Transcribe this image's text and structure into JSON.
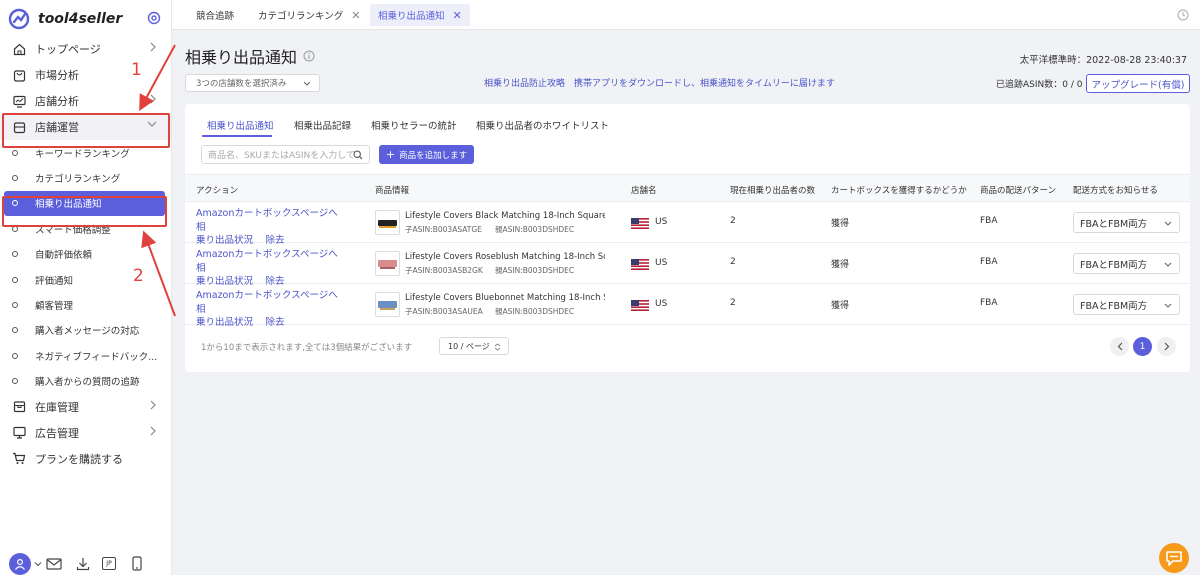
{
  "app": {
    "brand": "tool4seller"
  },
  "sidebar": {
    "items": [
      {
        "label": "トップページ",
        "icon": "home-icon",
        "chevron": true
      },
      {
        "label": "市場分析",
        "icon": "bag-icon",
        "chevron": false
      },
      {
        "label": "店舗分析",
        "icon": "chart-monitor-icon",
        "chevron": true
      },
      {
        "label": "店舗運営",
        "icon": "store-icon",
        "chevron": true,
        "open": true
      }
    ],
    "subitems": [
      {
        "label": "キーワードランキング"
      },
      {
        "label": "カテゴリランキング"
      },
      {
        "label": "相乗り出品通知",
        "active": true
      },
      {
        "label": "スマート価格調整"
      },
      {
        "label": "自動評価依頼"
      },
      {
        "label": "評価通知"
      },
      {
        "label": "顧客管理"
      },
      {
        "label": "購入者メッセージの対応"
      },
      {
        "label": "ネガティブフィードバック..."
      },
      {
        "label": "購入者からの質問の追跡"
      }
    ],
    "items_after": [
      {
        "label": "在庫管理",
        "icon": "box-icon",
        "chevron": true
      },
      {
        "label": "広告管理",
        "icon": "monitor-icon",
        "chevron": true
      },
      {
        "label": "プランを購読する",
        "icon": "cart-icon",
        "chevron": false
      }
    ],
    "bottom": {
      "lang_badge": "JP"
    }
  },
  "tabs": [
    {
      "label": "競合追跡",
      "closable": false
    },
    {
      "label": "カテゴリランキング",
      "closable": true
    },
    {
      "label": "相乗り出品通知",
      "closable": true,
      "active": true
    }
  ],
  "page": {
    "title": "相乗り出品通知",
    "timezone": "太平洋標準時：2022-08-28 23:40:37",
    "store_select": "3つの店舗数を選択済み",
    "promo_text": "相乗り出品防止攻略　携帯アプリをダウンロードし、相乗通知をタイムリーに届けます",
    "tracked": "已追跡ASIN数：0 / 0",
    "upgrade": "アップグレード(有償)"
  },
  "subtabs": [
    "相乗り出品通知",
    "相乗出品記録",
    "相乗りセラーの統計",
    "相乗り出品者のホワイトリスト"
  ],
  "toolbar": {
    "search_placeholder": "商品名、SKUまたはASINを入力して",
    "add_label": "商品を追加します"
  },
  "table": {
    "headers": [
      "アクション",
      "商品情報",
      "店舗名",
      "現在相乗り出品者の数",
      "カートボックスを獲得するかどうか",
      "商品の配送パターン",
      "配送方式をお知らせる"
    ],
    "rows": [
      {
        "action_line1": "Amazonカートボックスページへ　相",
        "action_line2": "乗り出品状況　 除去",
        "title": "Lifestyle Covers Black Matching 18-Inch Square ...",
        "child_asin": "子ASIN:B003ASATGE",
        "parent_asin": "親ASIN:B003DSHDEC",
        "country": "US",
        "sellers": "2",
        "buybox": "獲得",
        "fulfillment": "FBA",
        "notify": "FBAとFBM両方",
        "thumb_color": "#222222"
      },
      {
        "action_line1": "Amazonカートボックスページへ　相",
        "action_line2": "乗り出品状況　 除去",
        "title": "Lifestyle Covers Roseblush Matching 18-Inch Sq...",
        "child_asin": "子ASIN:B003ASB2GK",
        "parent_asin": "親ASIN:B003DSHDEC",
        "country": "US",
        "sellers": "2",
        "buybox": "獲得",
        "fulfillment": "FBA",
        "notify": "FBAとFBM両方",
        "thumb_color": "#d98c8c"
      },
      {
        "action_line1": "Amazonカートボックスページへ　相",
        "action_line2": "乗り出品状況　 除去",
        "title": "Lifestyle Covers Bluebonnet Matching 18-Inch S...",
        "child_asin": "子ASIN:B003ASAUEA",
        "parent_asin": "親ASIN:B003DSHDEC",
        "country": "US",
        "sellers": "2",
        "buybox": "獲得",
        "fulfillment": "FBA",
        "notify": "FBAとFBM両方",
        "thumb_color": "#6c8fc4"
      }
    ]
  },
  "pagination": {
    "info": "1から10まで表示されます,全ては3個結果がございます",
    "page_size": "10 / ページ",
    "current": "1"
  },
  "annotations": {
    "one": "1",
    "two": "2",
    "color": "#e0413b"
  }
}
